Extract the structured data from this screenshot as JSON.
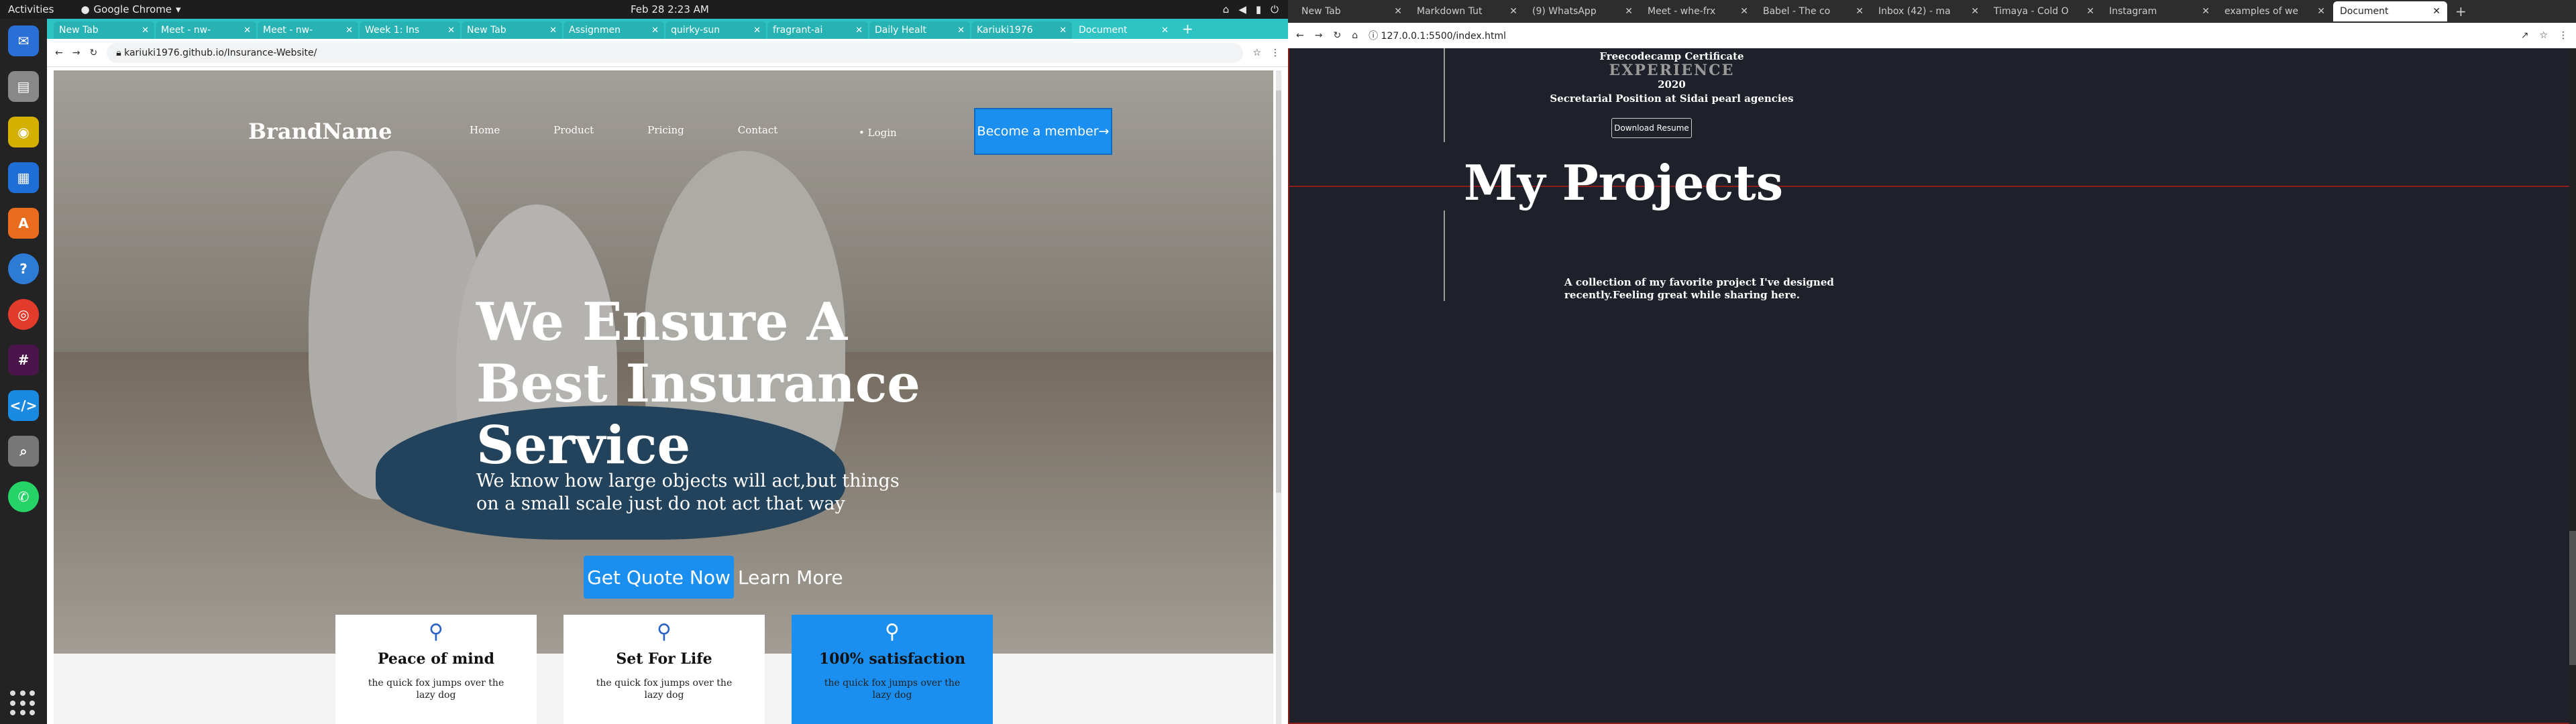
{
  "topbar": {
    "activities": "Activities",
    "app": "Google Chrome",
    "clock": "Feb 28  2:23 AM"
  },
  "dock": [
    "thunderbird",
    "files",
    "rhythmbox",
    "writer",
    "software",
    "help",
    "chrome",
    "slack",
    "vscode",
    "search",
    "whatsapp"
  ],
  "left": {
    "tabs": [
      "New Tab",
      "Meet - nw-",
      "Meet - nw-",
      "Week 1: Ins",
      "New Tab",
      "Assignmen",
      "quirky-sun",
      "fragrant-ai",
      "Daily Healt",
      "Kariuki1976",
      "Document"
    ],
    "url": "kariuki1976.github.io/Insurance-Website/",
    "page": {
      "brand": "BrandName",
      "nav": [
        "Home",
        "Product",
        "Pricing",
        "Contact"
      ],
      "login": "Login",
      "member": "Become a member→",
      "headline": "We Ensure A Best Insurance Service",
      "sub": "We know how large objects will act,but things on a small scale just do not act that way",
      "quote": "Get Quote Now",
      "learn": "Learn More",
      "cards": [
        {
          "title": "Peace of mind",
          "desc": "the quick fox jumps over the lazy dog"
        },
        {
          "title": "Set For Life",
          "desc": "the quick fox jumps over the lazy dog"
        },
        {
          "title": "100% satisfaction",
          "desc": "the quick fox jumps over the lazy dog"
        }
      ]
    }
  },
  "right": {
    "tabs": [
      "New Tab",
      "Markdown Tut",
      "(9) WhatsApp",
      "Meet - whe-frx",
      "Babel - The co",
      "Inbox (42) - ma",
      "Timaya - Cold O",
      "Instagram",
      "examples of we",
      "Document"
    ],
    "url": "127.0.0.1:5500/index.html",
    "page": {
      "cert": "Freecodecamp Certificate",
      "exp": "EXPERIENCE",
      "year": "2020",
      "position": "Secretarial Position at Sidai pearl agencies",
      "download": "Download Resume",
      "projects": "My Projects",
      "collection": "A collection of my favorite project I've designed recently.Feeling great while sharing here."
    }
  }
}
